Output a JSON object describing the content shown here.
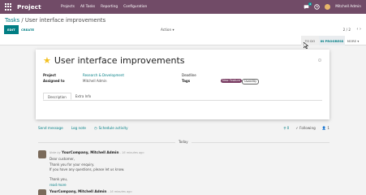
{
  "navbar": {
    "app_name": "Project",
    "menu": [
      "Projects",
      "All Tasks",
      "Reporting",
      "Configuration"
    ],
    "chat_badge": "4",
    "user": "Mitchell Admin"
  },
  "breadcrumb": {
    "parent": "Tasks",
    "separator": " / ",
    "current": "User interface improvements"
  },
  "buttons": {
    "edit": "EDIT",
    "create": "CREATE",
    "action": "Action"
  },
  "pager": {
    "value": "2 / 2"
  },
  "stages": {
    "todo": "TO DO",
    "in_progress": "IN PROGRESS",
    "more": "MORE"
  },
  "task": {
    "title": "User interface improvements",
    "project_label": "Project",
    "project_value": "Research & Development",
    "assigned_label": "Assigned to",
    "assigned_value": "Mitchell Admin",
    "deadline_label": "Deadline",
    "tags_label": "Tags",
    "tags": [
      "New Feature",
      "Usability"
    ]
  },
  "tabs": [
    "Description",
    "Extra Info"
  ],
  "chatter": {
    "send_message": "Send message",
    "log_note": "Log note",
    "schedule_activity": "Schedule activity",
    "attachments": "0",
    "following": "Following",
    "followers": "1",
    "today": "Today",
    "msg1": {
      "prefix": "Note by",
      "author": "YourCompany, Mitchell Admin",
      "time": "- 16 minutes ago",
      "lines": [
        "Dear customer,",
        "Thank you for your enquiry.",
        "If you have any questions, please let us know.",
        "Thank you,"
      ],
      "read_more": "read more"
    },
    "msg2": {
      "author": "YourCompany, Mitchell Admin",
      "time": "- 16 minutes ago"
    }
  },
  "colors": {
    "brand": "#714b67",
    "accent": "#017e84",
    "star": "#f3c01f"
  }
}
